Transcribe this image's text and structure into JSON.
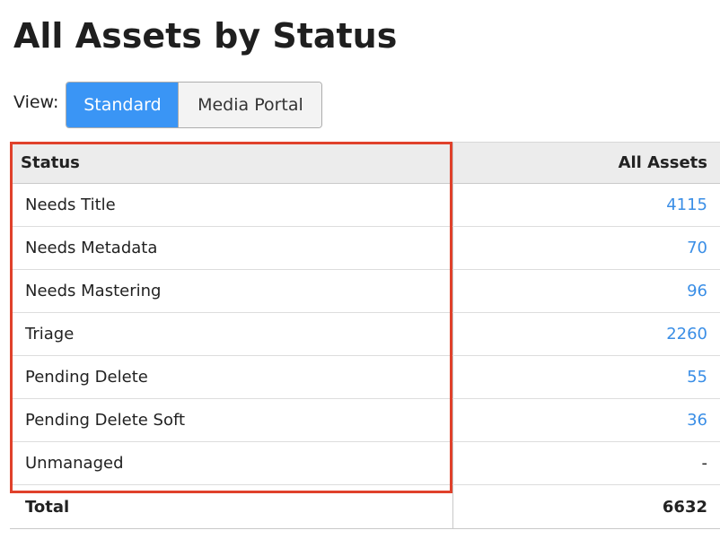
{
  "page": {
    "title": "All Assets by Status"
  },
  "view": {
    "label": "View:",
    "options": [
      {
        "label": "Standard",
        "active": true
      },
      {
        "label": "Media Portal",
        "active": false
      }
    ]
  },
  "table": {
    "headers": {
      "status": "Status",
      "count": "All Assets"
    },
    "rows": [
      {
        "status": "Needs Title",
        "count": "4115"
      },
      {
        "status": "Needs Metadata",
        "count": "70"
      },
      {
        "status": "Needs Mastering",
        "count": "96"
      },
      {
        "status": "Triage",
        "count": "2260"
      },
      {
        "status": "Pending Delete",
        "count": "55"
      },
      {
        "status": "Pending Delete Soft",
        "count": "36"
      },
      {
        "status": "Unmanaged",
        "count": "-"
      }
    ],
    "total": {
      "label": "Total",
      "count": "6632"
    }
  },
  "colors": {
    "accent": "#3a95f5",
    "link": "#3a8ee6",
    "highlight": "#e0412b",
    "header_bg": "#ececec"
  }
}
